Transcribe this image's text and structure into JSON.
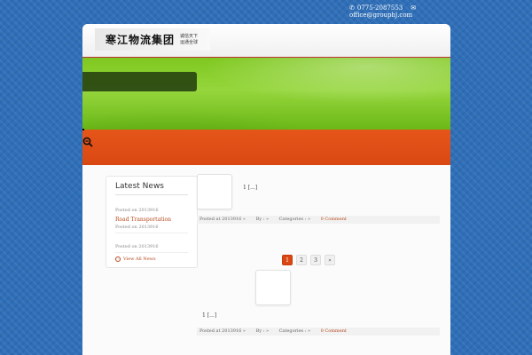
{
  "topbar": {
    "phone": "0775-2087553",
    "phone_icon": "phone-icon",
    "email": "office@grouphj.com",
    "email_icon": "envelope-icon"
  },
  "header": {
    "logo_text": "寒江物流集团",
    "slogan_line1": "诚信天下",
    "slogan_line2": "运通全球"
  },
  "sidebar": {
    "title": "Latest News",
    "items": [
      {
        "date": "Posted on 2013916",
        "title": ""
      },
      {
        "date": "Posted on 2013916",
        "title": "Road Transportation"
      },
      {
        "date": "Posted on 2013916",
        "title": ""
      }
    ],
    "view_all": "View All News"
  },
  "posts": [
    {
      "excerpt": "1 [...]",
      "posted": "Posted at 2013916 »",
      "by": "By : »",
      "categories": "Categories : »",
      "comments": "0 Comment"
    },
    {
      "excerpt": "1 [...]",
      "posted": "Posted at 2013916 »",
      "by": "By : »",
      "categories": "Categories : »",
      "comments": "0 Comment"
    }
  ],
  "pagination": {
    "pages": [
      "1",
      "2",
      "3"
    ],
    "next": "»",
    "current": "1"
  },
  "colors": {
    "accent": "#d94812",
    "link": "#b5481b",
    "banner_green": "#7fc81f",
    "background": "#2f6fb8"
  }
}
